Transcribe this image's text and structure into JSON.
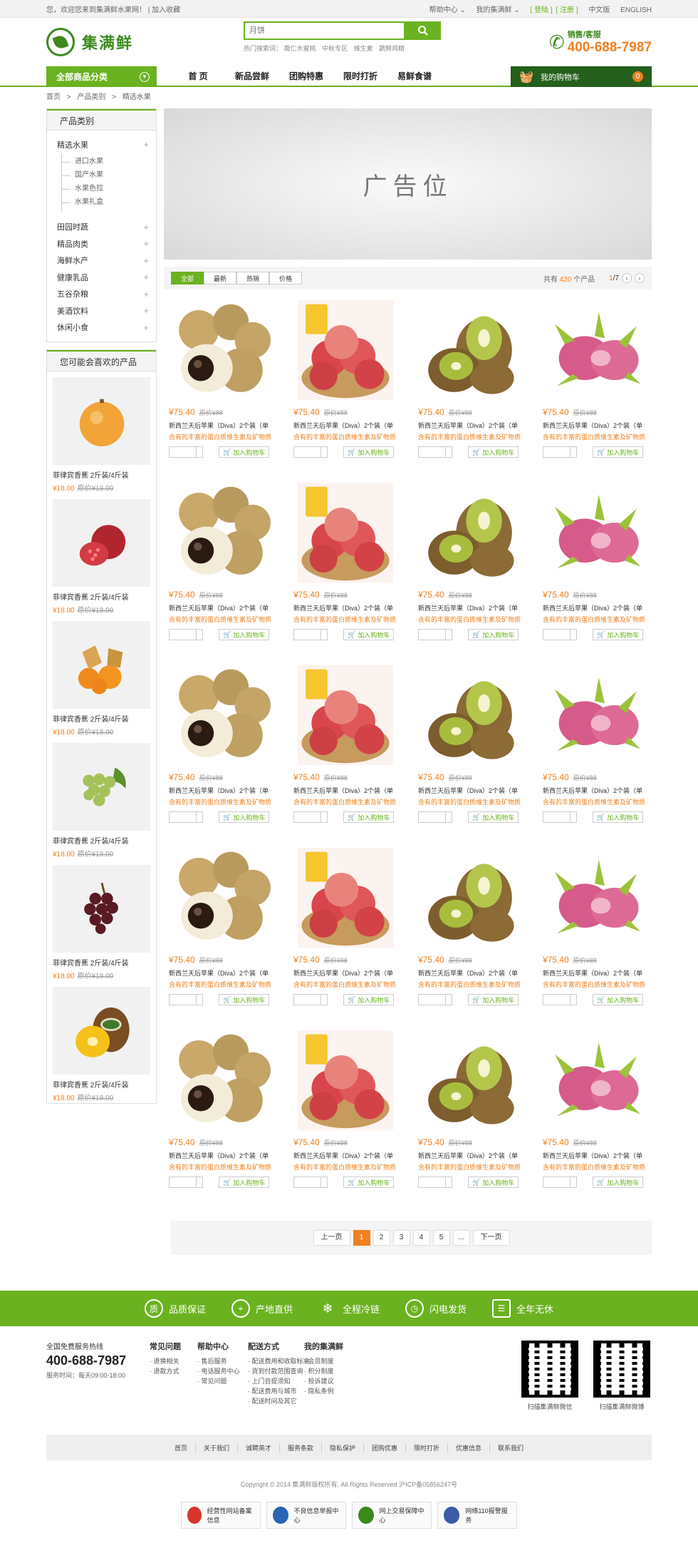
{
  "topbar": {
    "welcome": "您，欢迎您来到集满鲜水果网！",
    "join_fav": "| 加入收藏",
    "help": "帮助中心 ⌄",
    "my": "我的集满鲜 ⌄",
    "login": "[ 登陆 ]",
    "register": "[ 注册 ]",
    "chinese": "中文版",
    "english": "ENGLISH"
  },
  "header": {
    "logo_text": "集满鲜",
    "search_placeholder": "月饼",
    "hot_label": "热门搜索词：",
    "hot_terms": [
      "裔仁水蜜桃",
      "中秋专区",
      "维生素",
      "蔬鲜鸡精"
    ],
    "hotline_label": "销售/客服",
    "hotline_number": "400-688-7987"
  },
  "nav": {
    "all_categories": "全部商品分类",
    "items": [
      "首 页",
      "新品尝鲜",
      "团购特惠",
      "限时打折",
      "易鲜食谱"
    ],
    "cart_label": "我的购物车",
    "cart_count": "0"
  },
  "breadcrumb": [
    "首页",
    ">",
    "产品类别",
    ">",
    "精选水果"
  ],
  "sidebar": {
    "categories_title": "产品类别",
    "categories": [
      {
        "label": "精选水果",
        "children": [
          "进口水果",
          "国产水果",
          "水果色拉",
          "水果礼盒"
        ]
      },
      {
        "label": "田园时蔬",
        "children": []
      },
      {
        "label": "精品肉类",
        "children": []
      },
      {
        "label": "海鲜水产",
        "children": []
      },
      {
        "label": "健康乳品",
        "children": []
      },
      {
        "label": "五谷杂粮",
        "children": []
      },
      {
        "label": "美酒饮料",
        "children": []
      },
      {
        "label": "休闲小食",
        "children": []
      }
    ],
    "like_title": "您可能会喜欢的产品",
    "like_items": [
      {
        "name": "菲律宾香蕉  2斤装/4斤装",
        "price": "¥18.00",
        "orig": "原价¥18.00",
        "fruit": "orange"
      },
      {
        "name": "菲律宾香蕉  2斤装/4斤装",
        "price": "¥18.00",
        "orig": "原价¥18.00",
        "fruit": "pomegranate"
      },
      {
        "name": "菲律宾香蕉  2斤装/4斤装",
        "price": "¥18.00",
        "orig": "原价¥18.00",
        "fruit": "physalis"
      },
      {
        "name": "菲律宾香蕉  2斤装/4斤装",
        "price": "¥18.00",
        "orig": "原价¥18.00",
        "fruit": "grapes-green"
      },
      {
        "name": "菲律宾香蕉  2斤装/4斤装",
        "price": "¥18.00",
        "orig": "原价¥18.00",
        "fruit": "grapes-red"
      },
      {
        "name": "菲律宾香蕉  2斤装/4斤装",
        "price": "¥18.00",
        "orig": "原价¥18.00",
        "fruit": "kiwi-gold"
      }
    ]
  },
  "banner": {
    "text": "广告位"
  },
  "filter": {
    "tabs": [
      "全部",
      "最新",
      "热销",
      "价格"
    ],
    "total_prefix": "共有",
    "total_count": "420",
    "total_suffix": "个产品",
    "page_current": "1",
    "page_total": "/7"
  },
  "product_template": {
    "price": "¥75.40",
    "orig": "原价¥88",
    "name": "新西兰天后苹果（Diva）2个装（单",
    "desc": "含有的丰富的蛋白质维生素及矿物质",
    "add_cart": "加入购物车"
  },
  "product_fruits": [
    "longan",
    "apple",
    "kiwi",
    "dragonfruit"
  ],
  "product_rows": 5,
  "pager": {
    "prev": "上一页",
    "pages": [
      "1",
      "2",
      "3",
      "4",
      "5"
    ],
    "ellipsis": "...",
    "next": "下一页"
  },
  "services": [
    "品质保证",
    "产地直供",
    "全程冷链",
    "闪电发货",
    "全年无休"
  ],
  "footer": {
    "hotline_label": "全国免费服务热线",
    "hotline_number": "400-688-7987",
    "hours": "服务时间：每天09:00-18:00",
    "cols": [
      {
        "title": "常见问题",
        "items": [
          "· 退换相关",
          "· 退款方式"
        ]
      },
      {
        "title": "帮助中心",
        "items": [
          "· 售后服务",
          "· 电话服务中心",
          "· 常见问题"
        ]
      },
      {
        "title": "配送方式",
        "items": [
          "· 配送费用和收取标准",
          "· 货到付款范围查询",
          "· 上门自提须知",
          "· 配送费用与城市",
          "· 配送时间及其它"
        ]
      },
      {
        "title": "我的集满鲜",
        "items": [
          "· 会员制度",
          "· 积分制度",
          "· 投诉建议",
          "· 隐私条例"
        ]
      }
    ],
    "qr": [
      "扫描集满鲜微信",
      "扫描集满鲜微博"
    ],
    "links": [
      "首页",
      "关于我们",
      "诚聘英才",
      "服务条款",
      "隐私保护",
      "团购优惠",
      "限时打折",
      "优惠信息",
      "联系我们"
    ],
    "copyright": "Copyright © 2014 集满鲜版权所有, All Rights Reserved  沪ICP备05856247号",
    "badges": [
      "经营性网站备案信息",
      "不良信息举报中心",
      "网上交易保障中心",
      "网络110报警服务"
    ]
  },
  "colors": {
    "brand_green": "#6bb220",
    "dark_green": "#245f1c",
    "accent_orange": "#f08020"
  }
}
